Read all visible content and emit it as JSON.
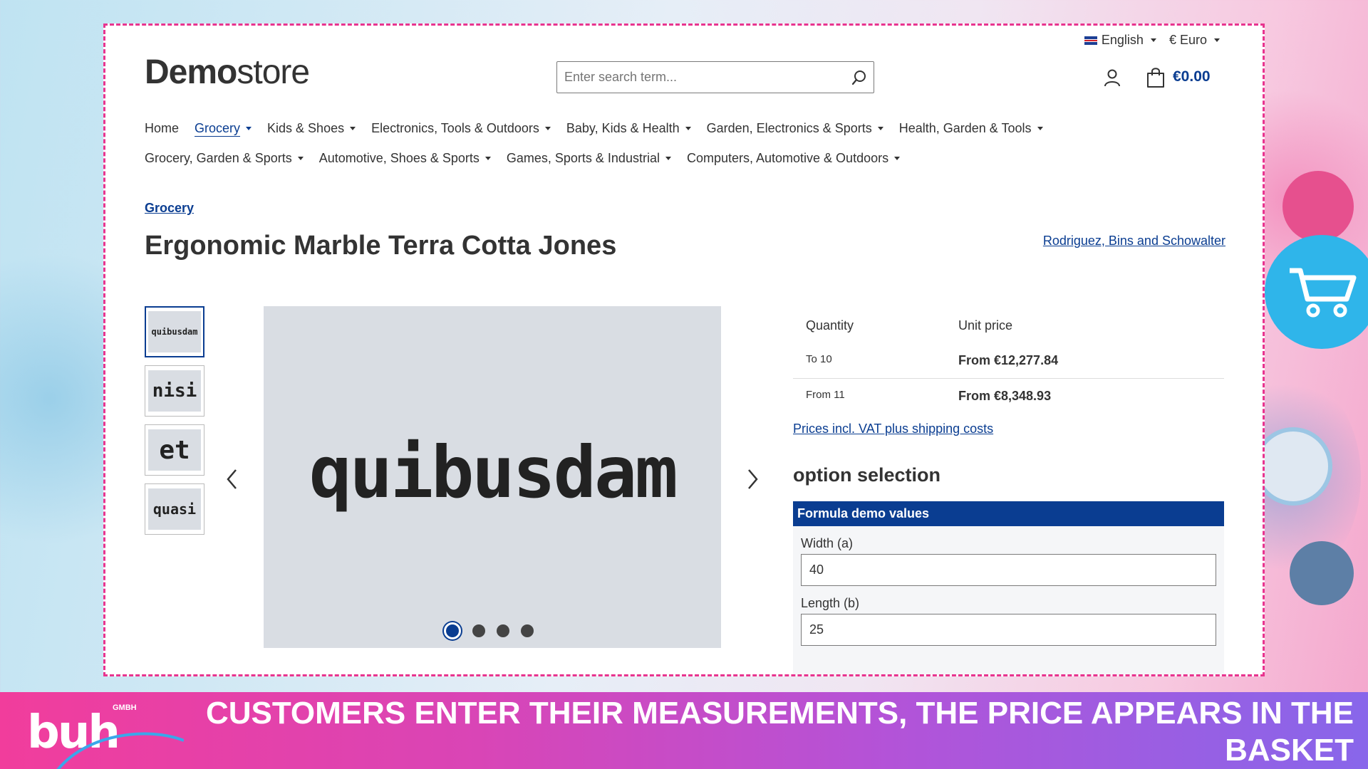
{
  "topbar": {
    "language": "English",
    "currency": "€ Euro"
  },
  "header": {
    "logo_bold": "Demo",
    "logo_light": "store",
    "search_placeholder": "Enter search term...",
    "cart_total": "€0.00"
  },
  "nav": {
    "row1": [
      {
        "label": "Home",
        "dropdown": false,
        "active": false
      },
      {
        "label": "Grocery",
        "dropdown": true,
        "active": true
      },
      {
        "label": "Kids & Shoes",
        "dropdown": true,
        "active": false
      },
      {
        "label": "Electronics, Tools & Outdoors",
        "dropdown": true,
        "active": false
      },
      {
        "label": "Baby, Kids & Health",
        "dropdown": true,
        "active": false
      },
      {
        "label": "Garden, Electronics & Sports",
        "dropdown": true,
        "active": false
      },
      {
        "label": "Health, Garden & Tools",
        "dropdown": true,
        "active": false
      }
    ],
    "row2": [
      {
        "label": "Grocery, Garden & Sports",
        "dropdown": true,
        "active": false
      },
      {
        "label": "Automotive, Shoes & Sports",
        "dropdown": true,
        "active": false
      },
      {
        "label": "Games, Sports & Industrial",
        "dropdown": true,
        "active": false
      },
      {
        "label": "Computers, Automotive & Outdoors",
        "dropdown": true,
        "active": false
      }
    ]
  },
  "product": {
    "breadcrumb": "Grocery",
    "title": "Ergonomic Marble Terra Cotta Jones",
    "manufacturer": "Rodriguez, Bins and Schowalter",
    "thumbnails": [
      "quibusdam",
      "nisi",
      "et",
      "quasi"
    ],
    "main_image_text": "quibusdam",
    "slide_count": 4,
    "active_slide": 1
  },
  "pricing": {
    "header_quantity": "Quantity",
    "header_unit_price": "Unit price",
    "rows": [
      {
        "quantity": "To 10",
        "price": "From €12,277.84"
      },
      {
        "quantity": "From 11",
        "price": "From €8,348.93"
      }
    ],
    "vat_link": "Prices incl. VAT plus shipping costs"
  },
  "options": {
    "title": "option selection",
    "group_title": "Formula demo values",
    "fields": [
      {
        "label": "Width (a)",
        "value": "40"
      },
      {
        "label": "Length (b)",
        "value": "25"
      }
    ]
  },
  "banner": {
    "brand": "buh",
    "brand_suffix": "GMBH",
    "caption": "CUSTOMERS ENTER THEIR MEASUREMENTS, THE PRICE APPEARS IN THE BASKET"
  },
  "colors": {
    "accent": "#0a3d91",
    "frame": "#e8348f",
    "banner_start": "#f13d9c",
    "banner_end": "#8866ea"
  }
}
